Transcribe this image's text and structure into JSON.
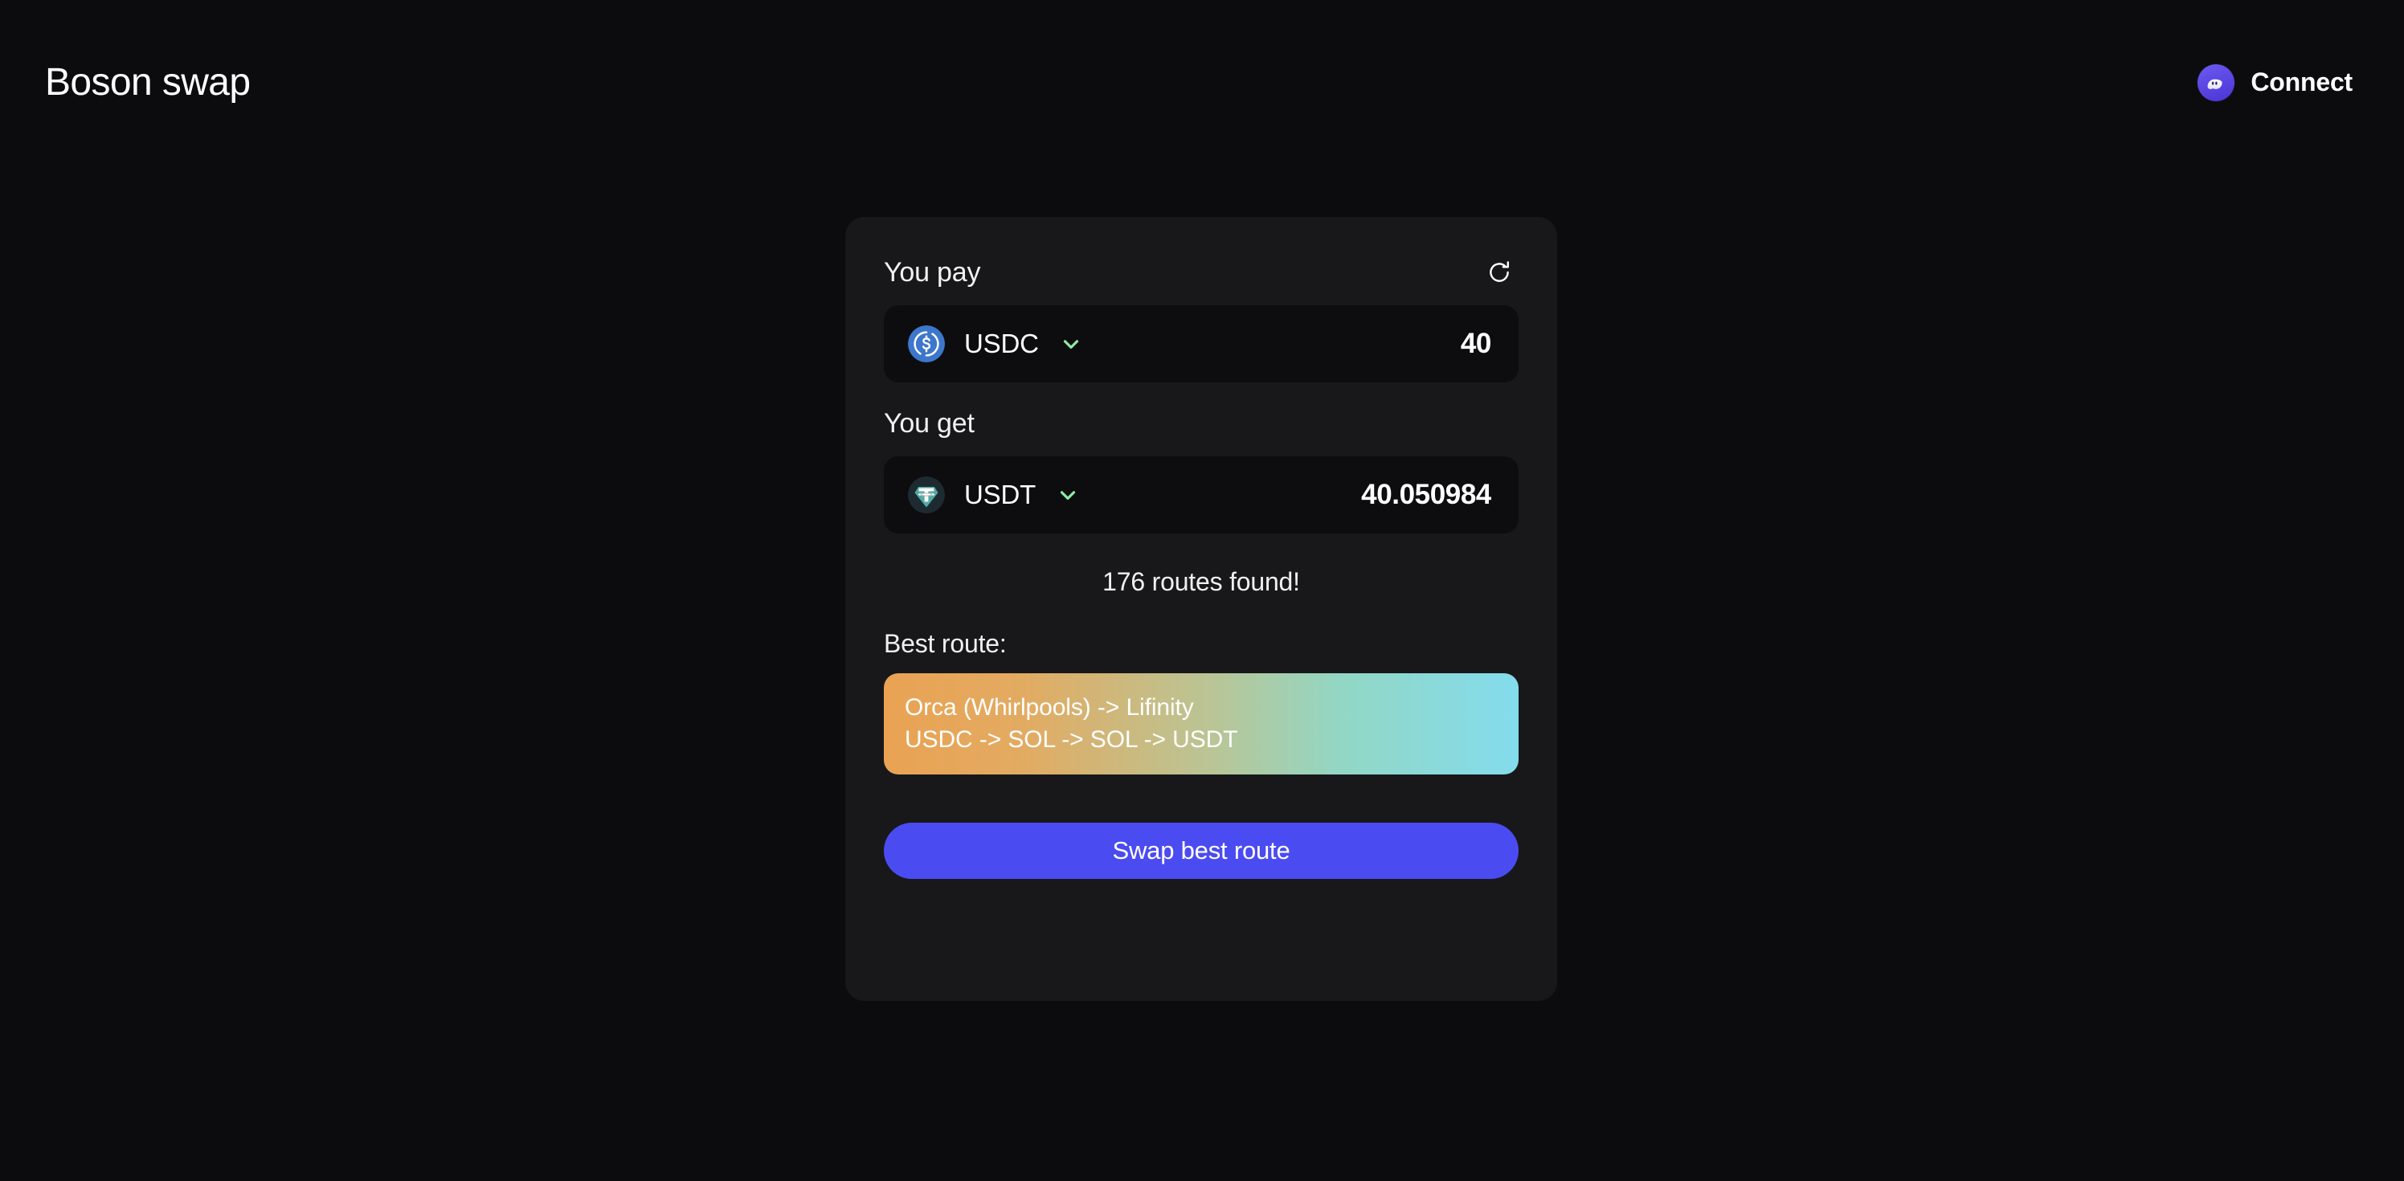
{
  "app": {
    "brand": "Boson swap",
    "background_color": "#0c0c0e",
    "card_color": "#18181b"
  },
  "header": {
    "connect_label": "Connect",
    "wallet_icon": "phantom-ghost-icon",
    "wallet_icon_color": "#5b45e0"
  },
  "swap": {
    "pay": {
      "label": "You pay",
      "token_symbol": "USDC",
      "token_icon": "usdc-coin-icon",
      "token_icon_color": "#3d77cc",
      "amount": "40",
      "amount_placeholder": "0.0",
      "chevron_icon": "chevron-down-icon",
      "chevron_color": "#8fe9a3"
    },
    "refresh_icon": "refresh-icon",
    "get": {
      "label": "You get",
      "token_symbol": "USDT",
      "token_icon": "usdt-tether-icon",
      "token_icon_color": "#53a8a5",
      "amount": "40.050984",
      "amount_placeholder": "0.0",
      "chevron_icon": "chevron-down-icon",
      "chevron_color": "#8fe9a3"
    },
    "routes_found": "176 routes found!",
    "best_route_label": "Best route:",
    "best_route": {
      "dex_path": "Orca (Whirlpools) -> Lifinity",
      "token_path": "USDC -> SOL -> SOL -> USDT",
      "gradient_start": "#eaa253",
      "gradient_end": "#83dced"
    },
    "swap_button_label": "Swap best route",
    "swap_button_color": "#4b4bf2"
  }
}
